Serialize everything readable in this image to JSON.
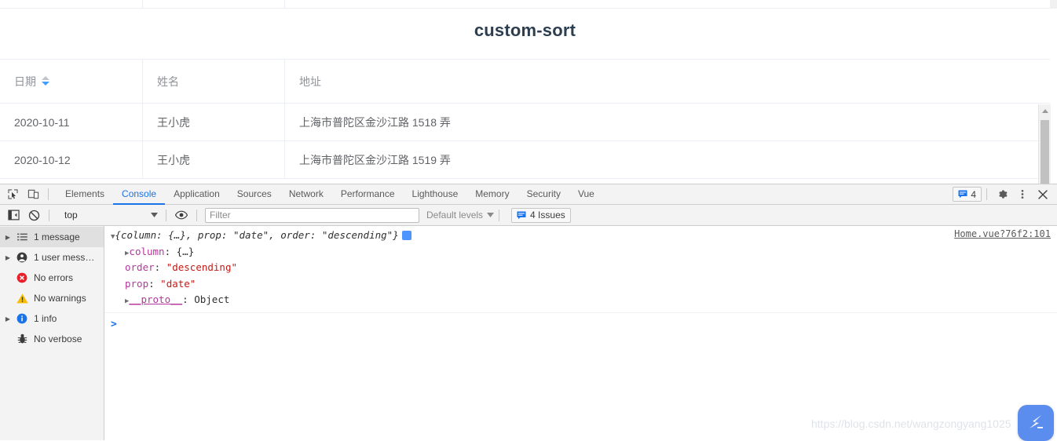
{
  "page": {
    "title": "custom-sort",
    "table": {
      "columns": [
        {
          "label": "日期",
          "sort_icon": "sort-caret-icon",
          "sort_state": "descending"
        },
        {
          "label": "姓名",
          "sort_icon": null,
          "sort_state": null
        },
        {
          "label": "地址",
          "sort_icon": null,
          "sort_state": null
        }
      ],
      "rows": [
        {
          "date": "2020-10-11",
          "name": "王小虎",
          "address": "上海市普陀区金沙江路 1518 弄"
        },
        {
          "date": "2020-10-12",
          "name": "王小虎",
          "address": "上海市普陀区金沙江路 1519 弄"
        }
      ]
    },
    "scrollbar": {
      "icon": "scroll-up-arrow-icon"
    }
  },
  "devtools": {
    "toolbar": {
      "inspect_icon": "inspect-element-icon",
      "device_icon": "device-toolbar-icon",
      "tabs": [
        {
          "label": "Elements",
          "active": false
        },
        {
          "label": "Console",
          "active": true
        },
        {
          "label": "Application",
          "active": false
        },
        {
          "label": "Sources",
          "active": false
        },
        {
          "label": "Network",
          "active": false
        },
        {
          "label": "Performance",
          "active": false
        },
        {
          "label": "Lighthouse",
          "active": false
        },
        {
          "label": "Memory",
          "active": false
        },
        {
          "label": "Security",
          "active": false
        },
        {
          "label": "Vue",
          "active": false
        }
      ],
      "message_count": "4",
      "message_icon": "speech-bubble-icon",
      "settings_icon": "gear-icon",
      "more_icon": "kebab-menu-icon",
      "close_icon": "close-icon"
    },
    "filterbar": {
      "sidebar_toggle_icon": "console-sidebar-toggle-icon",
      "clear_icon": "clear-console-icon",
      "context": "top",
      "context_caret": "chevron-down-icon",
      "eye_icon": "live-expression-eye-icon",
      "filter_value": "",
      "filter_placeholder": "Filter",
      "levels_label": "Default levels",
      "levels_caret": "chevron-down-icon",
      "issues_label": "4 Issues",
      "issues_icon": "issues-icon"
    },
    "sidebar": {
      "items": [
        {
          "label": "1 message",
          "icon": "list-icon",
          "expandable": true,
          "selected": true
        },
        {
          "label": "1 user mess…",
          "icon": "user-icon",
          "expandable": true,
          "selected": false
        },
        {
          "label": "No errors",
          "icon": "error-icon",
          "expandable": false,
          "selected": false
        },
        {
          "label": "No warnings",
          "icon": "warning-icon",
          "expandable": false,
          "selected": false
        },
        {
          "label": "1 info",
          "icon": "info-icon",
          "expandable": true,
          "selected": false
        },
        {
          "label": "No verbose",
          "icon": "verbose-bug-icon",
          "expandable": false,
          "selected": false
        }
      ]
    },
    "console": {
      "source_link": "Home.vue?76f2:101",
      "info_badge_icon": "info-badge-icon",
      "preview": {
        "triangle": "▼",
        "open_brace": "{",
        "key_column": "column: ",
        "column_value": "{…}, ",
        "key_prop": "prop: ",
        "prop_value": "\"date\"",
        "comma1": ", ",
        "key_order": "order: ",
        "order_value": "\"descending\"",
        "close_brace": "}"
      },
      "lines": [
        {
          "triangle": "▶",
          "key": "column",
          "sep": ": ",
          "value": "{…}",
          "value_kind": "object"
        },
        {
          "triangle": "",
          "key": "order",
          "sep": ": ",
          "value": "\"descending\"",
          "value_kind": "string"
        },
        {
          "triangle": "",
          "key": "prop",
          "sep": ": ",
          "value": "\"date\"",
          "value_kind": "string"
        },
        {
          "triangle": "▶",
          "key": "__proto__",
          "sep": ": ",
          "value": "Object",
          "value_kind": "proto"
        }
      ],
      "prompt": ">"
    }
  },
  "watermark": {
    "text": "https://blog.csdn.net/wangzongyang1025",
    "badge_icon": "csdn-logo-icon"
  },
  "colors": {
    "accent_blue": "#409eff",
    "devtools_blue": "#1a73e8",
    "title_navy": "#2c3e50",
    "string_red": "#c41a16",
    "key_magenta": "#b5379c"
  }
}
